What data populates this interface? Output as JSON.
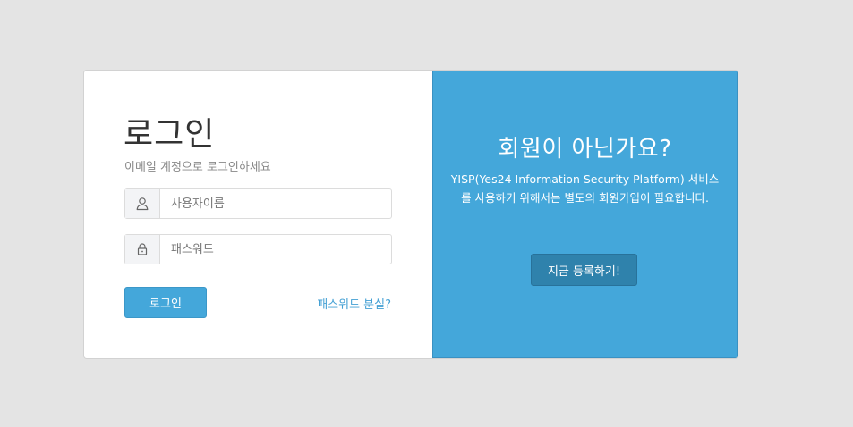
{
  "login": {
    "title": "로그인",
    "subtitle": "이메일 계정으로 로그인하세요",
    "username_placeholder": "사용자이름",
    "password_placeholder": "패스워드",
    "username_icon": "user-icon",
    "password_icon": "lock-icon",
    "submit_label": "로그인",
    "forgot_label": "패스워드 분실?"
  },
  "signup": {
    "title": "회원이 아닌가요?",
    "description": "YISP(Yes24 Information Security Platform) 서비스를 사용하기 위해서는 별도의 회원가입이 필요합니다.",
    "button_label": "지금 등록하기!"
  },
  "colors": {
    "accent": "#44a7da",
    "signup_button": "#2f82ac",
    "background": "#e4e4e4"
  }
}
